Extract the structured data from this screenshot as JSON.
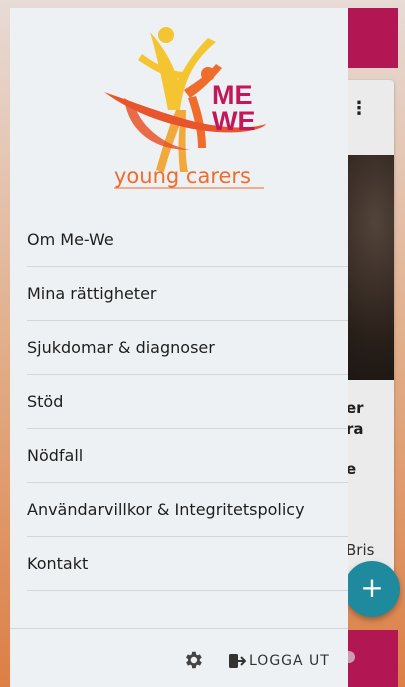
{
  "logo": {
    "brand_line1": "ME",
    "brand_line2": "WE",
    "tagline": "young carers",
    "icon": "me-we-logo"
  },
  "background": {
    "card_title_fragment_1": "er",
    "card_title_fragment_2": "ra",
    "card_text_fragment": "e",
    "card_footer_fragment": "Bris",
    "fab_label": "+",
    "kebab_icon": "more-vert-icon"
  },
  "drawer": {
    "menu_items": [
      {
        "label": "Om Me-We"
      },
      {
        "label": "Mina rättigheter"
      },
      {
        "label": "Sjukdomar & diagnoser"
      },
      {
        "label": "Stöd"
      },
      {
        "label": "Nödfall"
      },
      {
        "label": "Användarvillkor & Integritetspolicy"
      },
      {
        "label": "Kontakt"
      }
    ],
    "settings_icon": "gear-icon",
    "logout_label": "LOGGA UT",
    "logout_icon": "logout-icon"
  },
  "colors": {
    "accent_pink": "#c2185b",
    "fab_teal": "#1f8a9e",
    "logo_orange": "#ef6c2d",
    "logo_yellow": "#f4c431"
  }
}
